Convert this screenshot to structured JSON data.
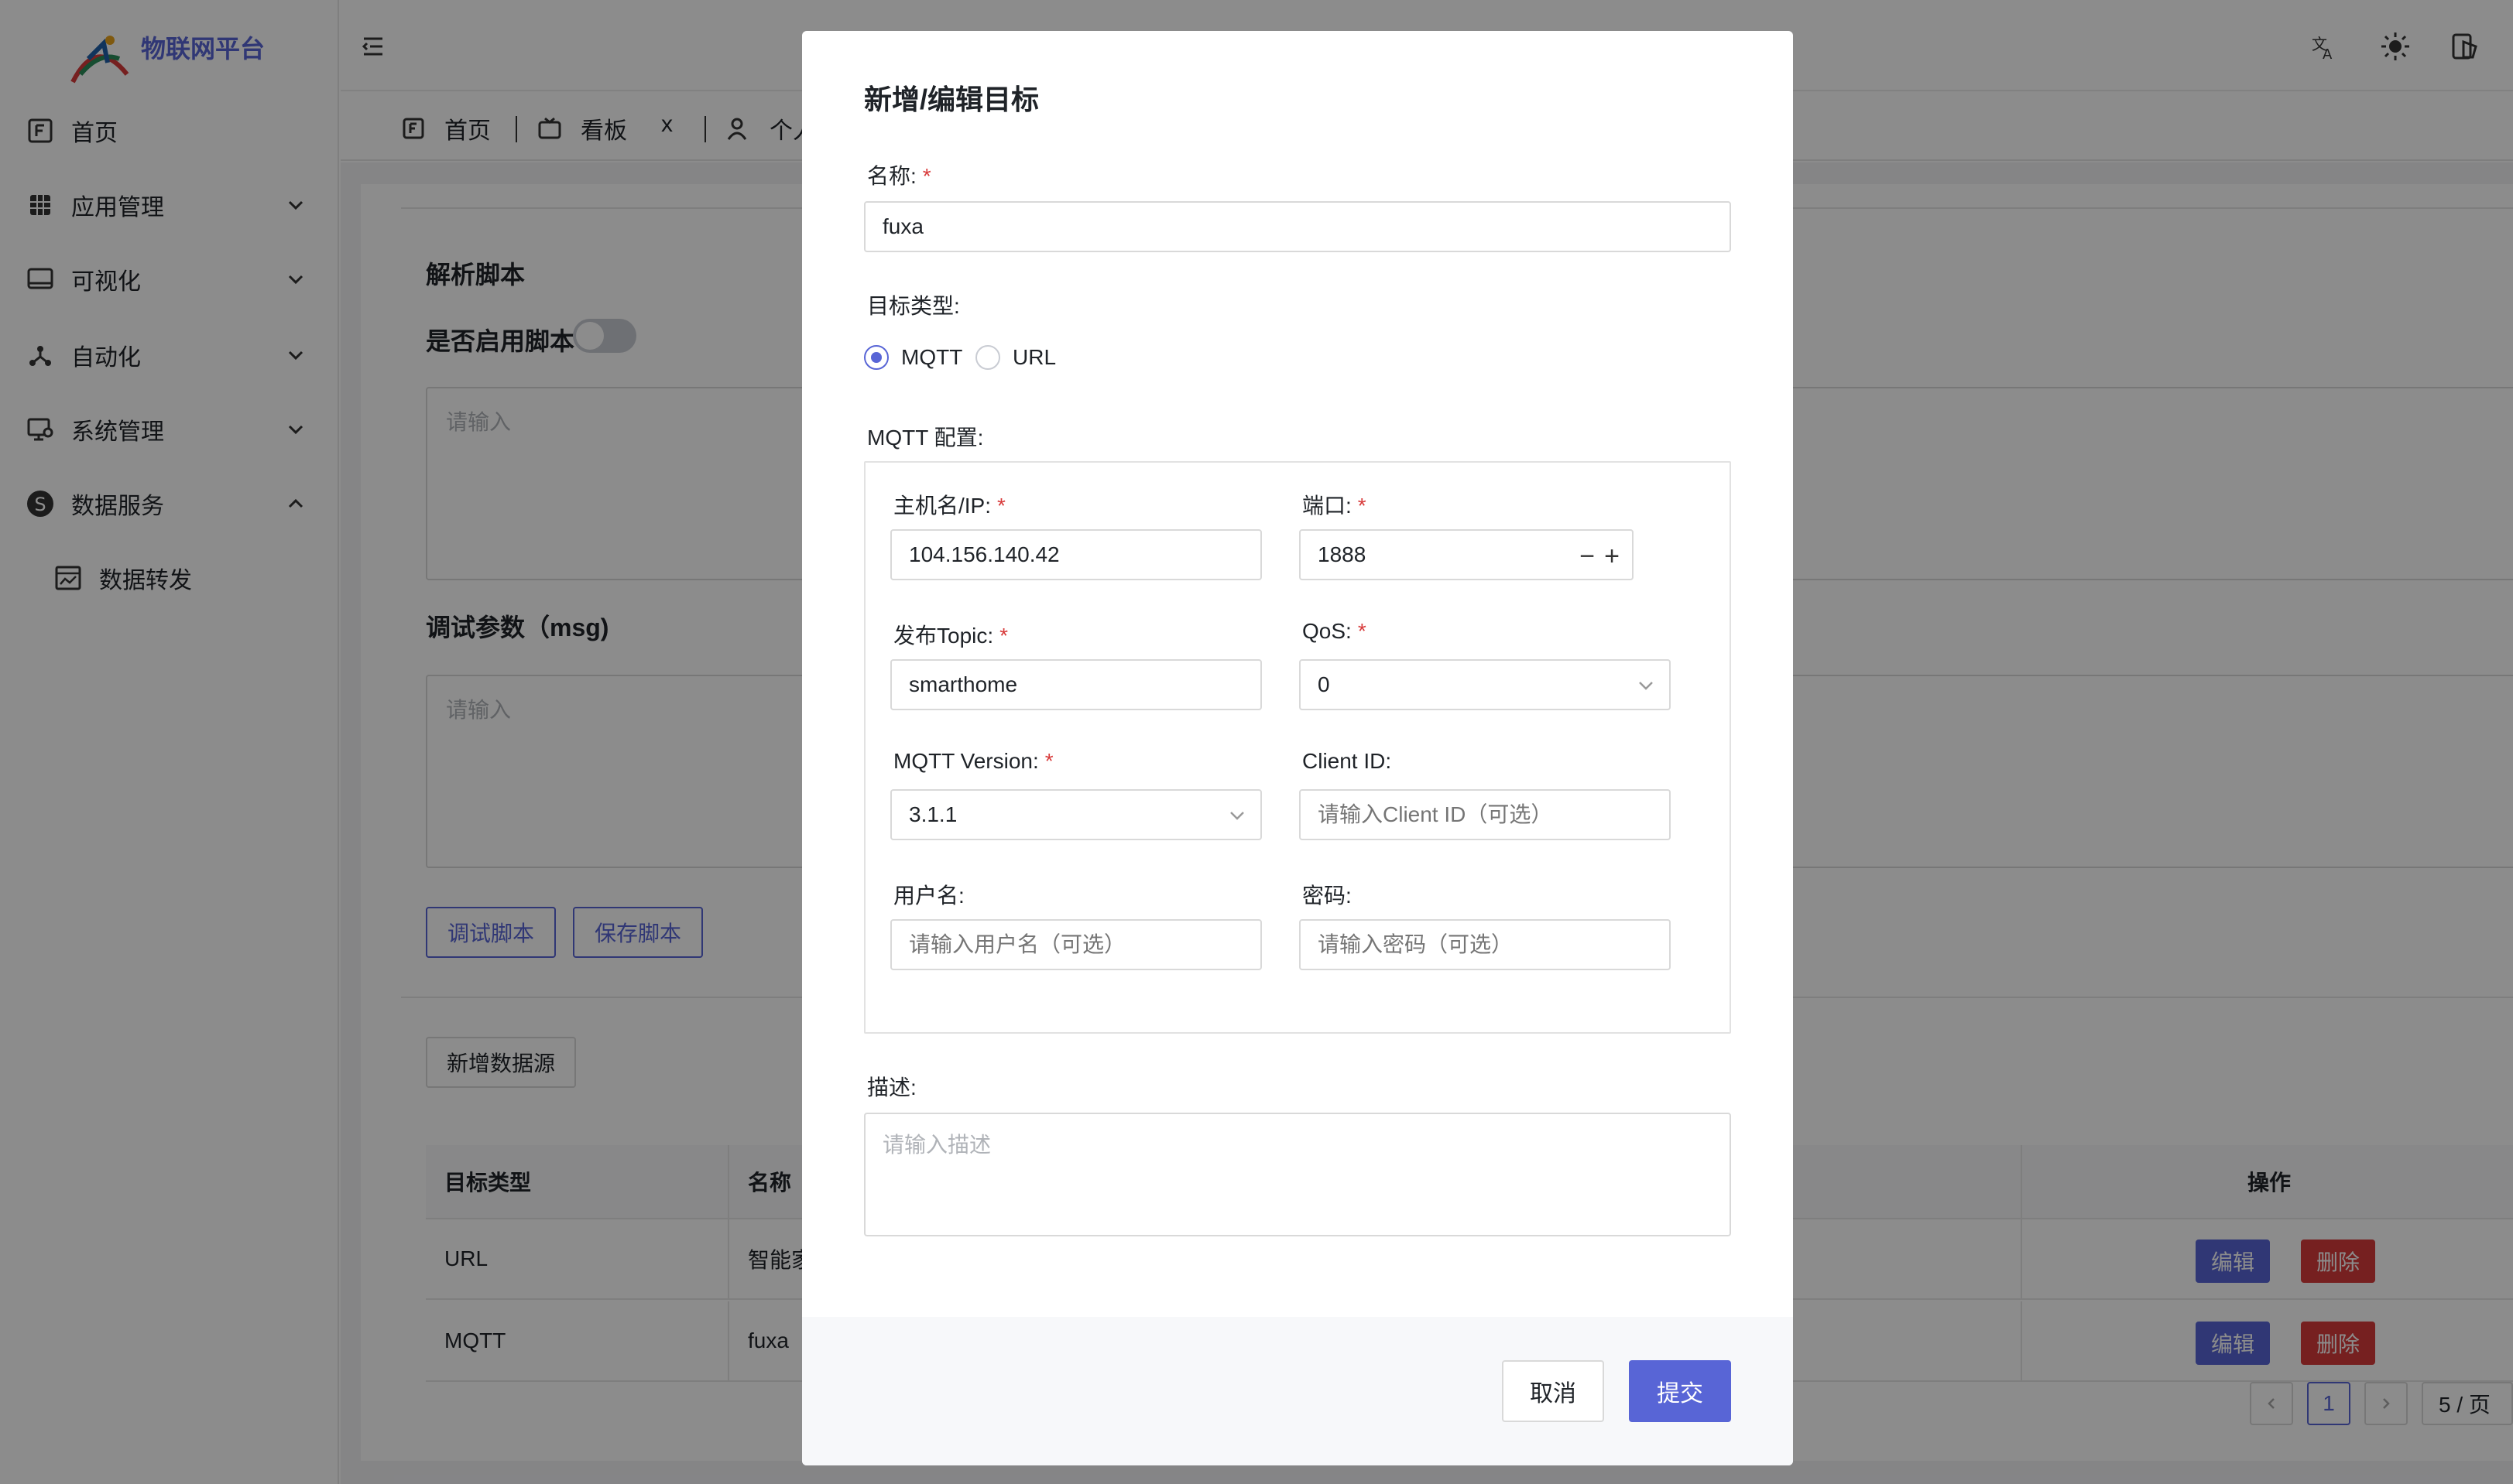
{
  "app": {
    "title": "物联网平台"
  },
  "sidebar": {
    "items": [
      {
        "label": "首页"
      },
      {
        "label": "应用管理"
      },
      {
        "label": "可视化"
      },
      {
        "label": "自动化"
      },
      {
        "label": "系统管理"
      },
      {
        "label": "数据服务"
      },
      {
        "label": "数据转发"
      }
    ]
  },
  "tabs": [
    {
      "label": "首页"
    },
    {
      "label": "看板",
      "close": "x"
    },
    {
      "label": "个人"
    }
  ],
  "page": {
    "script_section_title": "解析脚本",
    "enable_script_label": "是否启用脚本",
    "script_placeholder": "请输入",
    "debug_params_title": "调试参数（msg)",
    "debug_placeholder": "请输入",
    "debug_button": "调试脚本",
    "save_button": "保存脚本",
    "add_source_button": "新增数据源",
    "table": {
      "columns": [
        "目标类型",
        "名称",
        "操作"
      ],
      "rows": [
        {
          "type": "URL",
          "name": "智能家居",
          "edit": "编辑",
          "delete": "删除"
        },
        {
          "type": "MQTT",
          "name": "fuxa",
          "edit": "编辑",
          "delete": "删除"
        }
      ]
    },
    "pagination": {
      "current": "1",
      "page_size": "5 / 页"
    }
  },
  "modal": {
    "title": "新增/编辑目标",
    "name_label": "名称:",
    "name_value": "fuxa",
    "target_type_label": "目标类型:",
    "target_options": [
      {
        "label": "MQTT",
        "selected": true
      },
      {
        "label": "URL",
        "selected": false
      }
    ],
    "mqtt_config_label": "MQTT 配置:",
    "host_label": "主机名/IP:",
    "host_value": "104.156.140.42",
    "port_label": "端口:",
    "port_value": "1888",
    "topic_label": "发布Topic:",
    "topic_value": "smarthome",
    "qos_label": "QoS:",
    "qos_value": "0",
    "version_label": "MQTT Version:",
    "version_value": "3.1.1",
    "client_id_label": "Client ID:",
    "client_id_placeholder": "请输入Client ID（可选）",
    "username_label": "用户名:",
    "username_placeholder": "请输入用户名（可选）",
    "password_label": "密码:",
    "password_placeholder": "请输入密码（可选）",
    "description_label": "描述:",
    "description_placeholder": "请输入描述",
    "cancel_label": "取消",
    "submit_label": "提交",
    "required_mark": "*"
  },
  "colors": {
    "accent": "#5865d6",
    "danger": "#d83b3b",
    "mask": "rgba(0,0,0,0.45)"
  }
}
